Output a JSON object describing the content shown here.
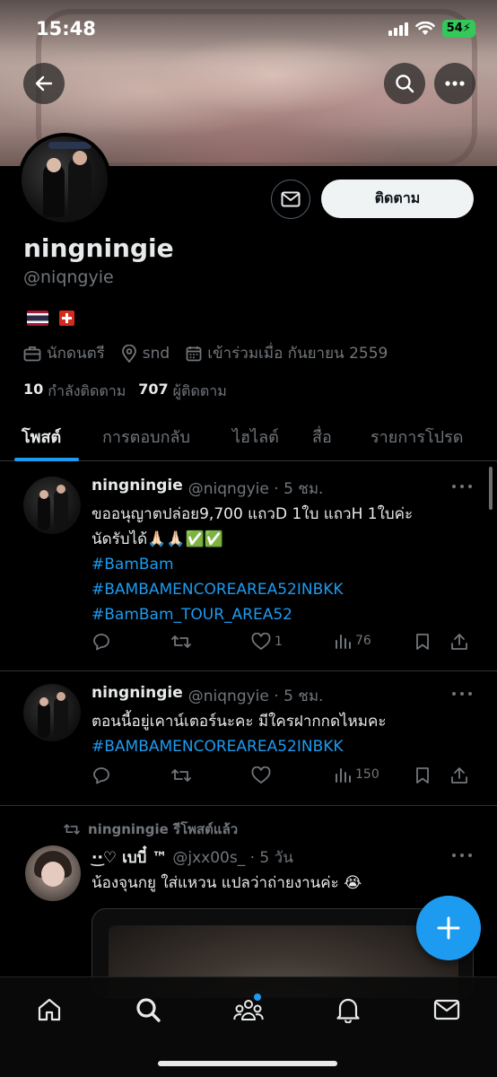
{
  "status_bar": {
    "time": "15:48",
    "battery": "54"
  },
  "profile": {
    "action_button": "ติดตาม",
    "display_name": "ningningie",
    "handle": "@niqngyie",
    "profession": "นักดนตรี",
    "location": "snd",
    "joined": "เข้าร่วมเมื่อ กันยายน 2559",
    "following_count": "10",
    "following_label": "กำลังติดตาม",
    "followers_count": "707",
    "followers_label": "ผู้ติดตาม"
  },
  "tabs": [
    {
      "label": "โพสต์"
    },
    {
      "label": "การตอบกลับ"
    },
    {
      "label": "ไฮไลต์"
    },
    {
      "label": "สื่อ"
    },
    {
      "label": "รายการโปรด"
    }
  ],
  "posts": [
    {
      "name": "ningningie",
      "meta": "@niqngyie · 5 ชม.",
      "lines": [
        "ขออนุญาตปล่อย9,700 แถวD 1ใบ แถวH 1ใบค่ะ",
        "นัดรับได้🙏🏻🙏🏻✅✅"
      ],
      "tags": [
        "#BamBam",
        "#BAMBAMENCOREAREA52INBKK",
        "#BamBam_TOUR_AREA52"
      ],
      "likes": "1",
      "views": "76"
    },
    {
      "name": "ningningie",
      "meta": "@niqngyie · 5 ชม.",
      "lines": [
        "ตอนนี้อยู่เคาน์เตอร์นะคะ มีใครฝากกดไหมคะ"
      ],
      "tags": [
        "#BAMBAMENCOREAREA52INBKK"
      ],
      "likes": "",
      "views": "150"
    },
    {
      "repost_label": "ningningie รีโพสต์แล้ว",
      "name": "·͜·♡ เบบี๋ ™",
      "meta": "@jxx00s_ · 5 วัน",
      "lines": [
        "น้องจุนกยู ใส่แหวน แปลว่าถ่ายงานค่ะ 😭"
      ]
    }
  ]
}
